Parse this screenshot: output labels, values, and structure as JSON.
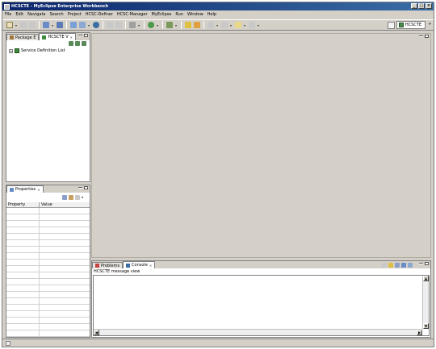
{
  "window": {
    "title": "HCSCTE - MyEclipse Enterprise Workbench",
    "minimize": "_",
    "maximize": "□",
    "close": "×"
  },
  "menu": [
    "File",
    "Edit",
    "Navigate",
    "Search",
    "Project",
    "HCSC-Definer",
    "HCSC-Manager",
    "MyEclipse",
    "Run",
    "Window",
    "Help"
  ],
  "perspective": {
    "label": "HCSCTE",
    "more": "»"
  },
  "left_top_panel": {
    "tabs": [
      {
        "label": "Package E"
      },
      {
        "label": "HCSCTE V"
      }
    ],
    "tree": [
      {
        "label": "Service Definition List",
        "expander": "+"
      }
    ]
  },
  "properties_panel": {
    "tab": "Properties",
    "columns": [
      "Property",
      "Value"
    ]
  },
  "bottom_panel": {
    "tabs": [
      {
        "label": "Problems"
      },
      {
        "label": "Console"
      }
    ],
    "message": "HCSCTE message view"
  },
  "colors": {
    "titlebar": "#0a246a",
    "chrome": "#d4d0c8"
  }
}
